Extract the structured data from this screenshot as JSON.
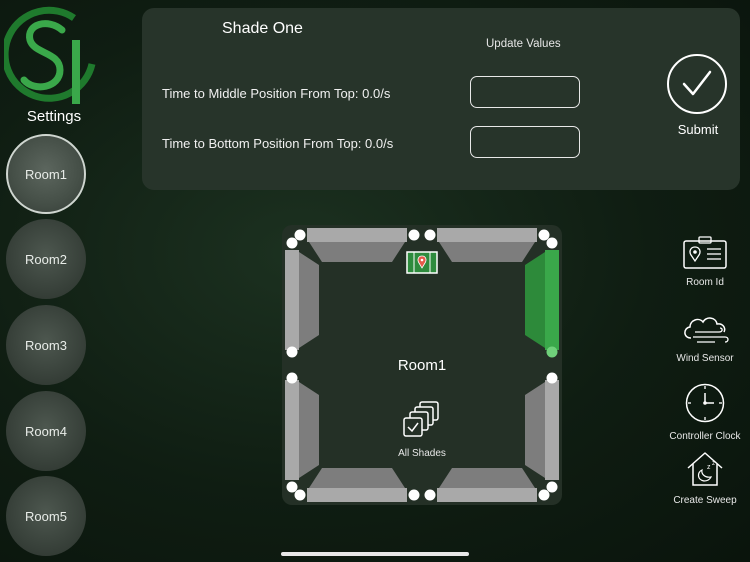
{
  "sidebar": {
    "settings_label": "Settings",
    "rooms": [
      {
        "label": "Room1",
        "active": true
      },
      {
        "label": "Room2",
        "active": false
      },
      {
        "label": "Room3",
        "active": false
      },
      {
        "label": "Room4",
        "active": false
      },
      {
        "label": "Room5",
        "active": false
      }
    ]
  },
  "panel": {
    "shade_title": "Shade One",
    "update_values_label": "Update Values",
    "middle_label": "Time to Middle Position From Top: 0.0/s",
    "bottom_label": "Time to Bottom Position From Top: 0.0/s",
    "middle_value": "",
    "bottom_value": "",
    "submit_label": "Submit"
  },
  "room_map": {
    "room_name": "Room1",
    "all_shades_label": "All Shades",
    "active_shade": "right-top",
    "colors": {
      "accent": "#3aa84a",
      "shade_gray": "#a9a9a9",
      "shade_dark": "#7d7d7d",
      "background": "#243026"
    }
  },
  "right_menu": {
    "items": [
      {
        "label": "Room Id",
        "icon": "id-card-icon"
      },
      {
        "label": "Wind Sensor",
        "icon": "wind-cloud-icon"
      },
      {
        "label": "Controller Clock",
        "icon": "clock-icon"
      },
      {
        "label": "Create Sweep",
        "icon": "house-sleep-icon"
      }
    ]
  },
  "brand": {
    "accent": "#2f9e3e",
    "logo_letters": "SI"
  }
}
